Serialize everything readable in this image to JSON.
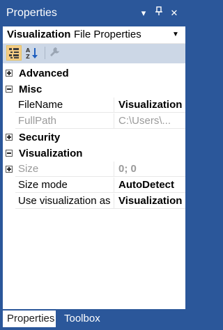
{
  "window": {
    "title": "Properties",
    "controls": [
      {
        "name": "menu-dropdown-icon",
        "glyph": "▾"
      },
      {
        "name": "pin-icon",
        "glyph": "⊥"
      },
      {
        "name": "close-icon",
        "glyph": "✕"
      }
    ]
  },
  "object_selector": {
    "name": "Visualization",
    "type": "File Properties",
    "dropdown_glyph": "▼"
  },
  "toolbar": {
    "buttons": [
      "categorized-icon",
      "alphabetical-icon",
      "property-pages-icon"
    ],
    "active": "categorized-icon"
  },
  "grid": {
    "categories": [
      {
        "label": "Advanced",
        "expanded": false,
        "properties": []
      },
      {
        "label": "Misc",
        "expanded": true,
        "properties": [
          {
            "name": "FileName",
            "value": "Visualization",
            "bold": true,
            "readonly": false
          },
          {
            "name": "FullPath",
            "value": "C:\\Users\\...",
            "bold": false,
            "readonly": true
          }
        ]
      },
      {
        "label": "Security",
        "expanded": false,
        "properties": []
      },
      {
        "label": "Visualization",
        "expanded": true,
        "properties": [
          {
            "name": "Size",
            "value": "0; 0",
            "bold": true,
            "readonly": true,
            "expandable": true
          },
          {
            "name": "Size mode",
            "value": "AutoDetect",
            "bold": true,
            "readonly": false
          },
          {
            "name": "Use visualization as",
            "value": "Visualization",
            "bold": true,
            "readonly": false
          }
        ]
      }
    ]
  },
  "tabs": {
    "items": [
      "Properties",
      "Toolbox"
    ],
    "active": "Properties"
  },
  "colors": {
    "accent": "#2b579a",
    "toolbar": "#ccd7e6",
    "active_button": "#f5cc84"
  }
}
